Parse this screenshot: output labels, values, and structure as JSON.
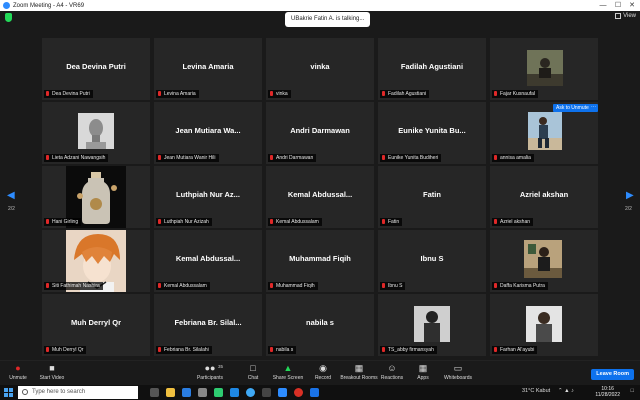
{
  "window": {
    "title": "Zoom Meeting - A4 - VR69",
    "minimize": "—",
    "maximize": "☐",
    "close": "✕",
    "view_label": "View"
  },
  "talking": "UBakrie Fatin A. is talking...",
  "ask_to_unmute": "Ask to Unmute",
  "more": "···",
  "page_left": "2/2",
  "page_right": "2/2",
  "tiles": [
    {
      "name": "Dea Devina Putri",
      "label": "Dea Devina Putri"
    },
    {
      "name": "Levina Amaria",
      "label": "Levina Amaria"
    },
    {
      "name": "vinka",
      "label": "vinka"
    },
    {
      "name": "Fadilah Agustiani",
      "label": "Fadilah Agustiani"
    },
    {
      "name": "",
      "label": "Fajar Kusnaufal"
    },
    {
      "name": "",
      "label": "Lieta Adzani Nawangsih"
    },
    {
      "name": "Jean Mutiara Wa...",
      "label": "Jean Mutiara Wanir Hili"
    },
    {
      "name": "Andri Darmawan",
      "label": "Andri Darmawan"
    },
    {
      "name": "Eunike Yunita Bu...",
      "label": "Eunike Yunita Budiheri"
    },
    {
      "name": "",
      "label": "annisa amalia"
    },
    {
      "name": "",
      "label": "Hani Girling"
    },
    {
      "name": "Luthpiah Nur Az...",
      "label": "Luthpiah Nur Azizah"
    },
    {
      "name": "Kemal  Abdussal...",
      "label": "Kemal Abdussalam"
    },
    {
      "name": "Fatin",
      "label": "Fatin"
    },
    {
      "name": "Azriel akshan",
      "label": "Azriel akshan"
    },
    {
      "name": "",
      "label": "Siti Fathimah Nashira"
    },
    {
      "name": "Kemal  Abdussal...",
      "label": "Kemal Abdussalam"
    },
    {
      "name": "Muhammad Fiqih",
      "label": "Muhammad Fiqih"
    },
    {
      "name": "Ibnu S",
      "label": "Ibnu S"
    },
    {
      "name": "",
      "label": "Daffa Karisma Putra"
    },
    {
      "name": "Muh Derryl Qr",
      "label": "Muh Derryl Qr"
    },
    {
      "name": "Febriana  Br. Silal...",
      "label": "Febriana Br. Silalahi"
    },
    {
      "name": "nabila s",
      "label": "nabila s"
    },
    {
      "name": "",
      "label": "TS_abby firmansyah"
    },
    {
      "name": "",
      "label": "Farhan Al'ayubi"
    }
  ],
  "toolbar": {
    "unmute": "Unmute",
    "start_video": "Start Video",
    "participants": "Participants",
    "participants_count": "35",
    "chat": "Chat",
    "share_screen": "Share Screen",
    "record": "Record",
    "breakout_rooms": "Breakout Rooms",
    "reactions": "Reactions",
    "apps": "Apps",
    "whiteboards": "Whiteboards",
    "leave": "Leave Room"
  },
  "taskbar": {
    "search_placeholder": "Type here to search",
    "weather": "31°C  Kabut",
    "time": "10:16",
    "date": "11/28/2022"
  },
  "colors": {
    "accent": "#0e72ed",
    "zoom_blue": "#2d8cff",
    "muted_red": "#e02828",
    "secure_green": "#23d959",
    "tile_bg": "#262626"
  }
}
